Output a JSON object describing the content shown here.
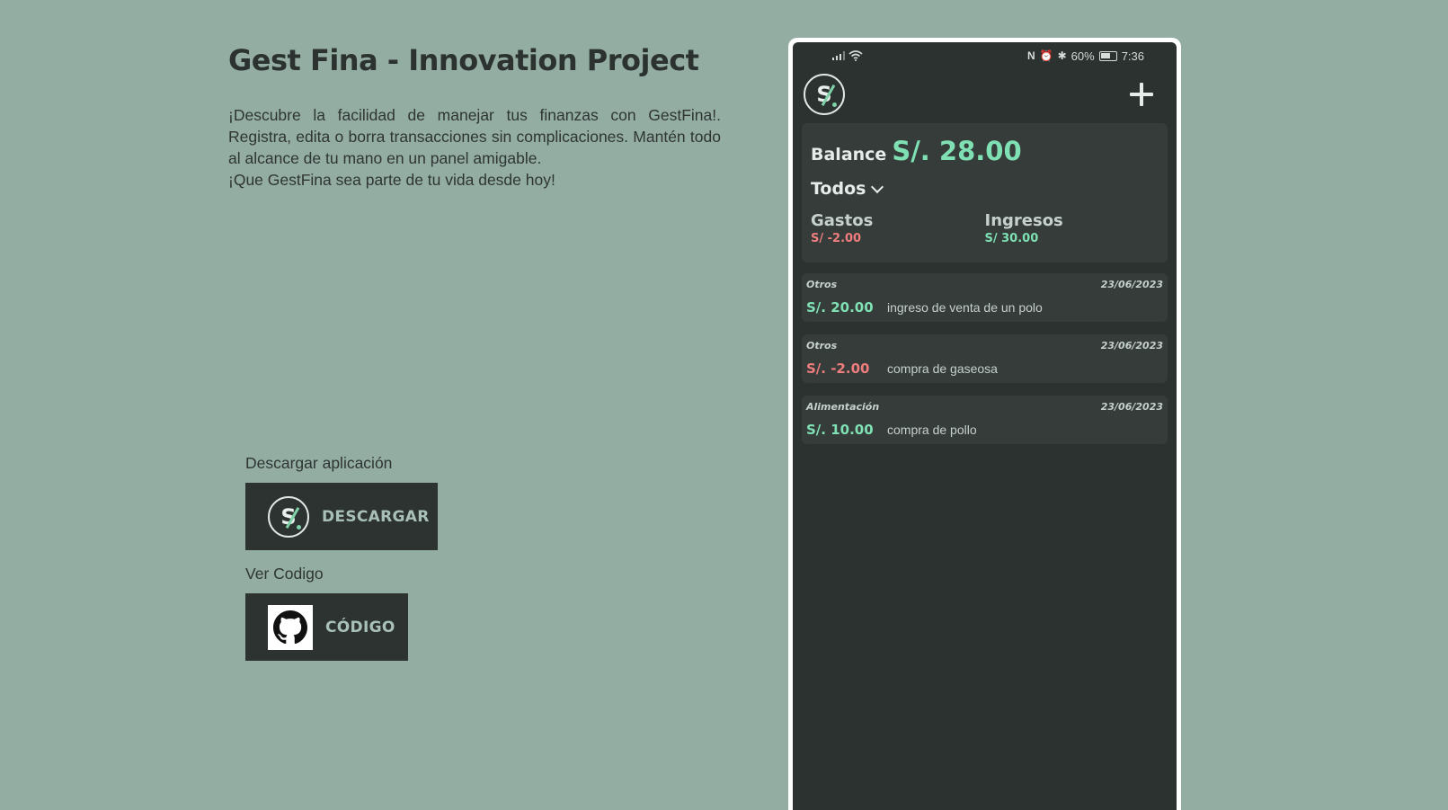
{
  "header": {
    "title": "Gest Fina - Innovation Project"
  },
  "description": {
    "line1": "¡Descubre la facilidad de manejar tus finanzas con GestFina!. Registra, edita o borra transacciones sin complicaciones. Mantén todo al alcance de tu mano en un panel amigable.",
    "line2": "¡Que GestFina sea parte de tu vida desde hoy!"
  },
  "downloads": {
    "app_label": "Descargar aplicación",
    "download_button": "DESCARGAR",
    "code_label": "Ver Codigo",
    "code_button": "CÓDIGO"
  },
  "phone": {
    "status": {
      "battery": "60%",
      "time": "7:36"
    },
    "logo_text": "S/.",
    "balance_label": "Balance",
    "balance_value": "S/. 28.00",
    "filter": "Todos",
    "expenses_label": "Gastos",
    "expenses_value": "S/ -2.00",
    "income_label": "Ingresos",
    "income_value": "S/ 30.00",
    "transactions": [
      {
        "category": "Otros",
        "date": "23/06/2023",
        "amount": "S/. 20.00",
        "description": "ingreso de venta de un polo",
        "type": "income"
      },
      {
        "category": "Otros",
        "date": "23/06/2023",
        "amount": "S/. -2.00",
        "description": "compra de gaseosa",
        "type": "expense"
      },
      {
        "category": "Alimentación",
        "date": "23/06/2023",
        "amount": "S/. 10.00",
        "description": "compra de pollo",
        "type": "income"
      }
    ]
  },
  "colors": {
    "background": "#94ada3",
    "dark": "#2d3331",
    "accent_green": "#7fe0b4",
    "accent_red": "#ef7d7d"
  },
  "icons": {
    "app_logo": "gestfina-logo-icon",
    "github": "github-icon",
    "add": "plus-icon",
    "filter": "chevron-down-icon"
  }
}
